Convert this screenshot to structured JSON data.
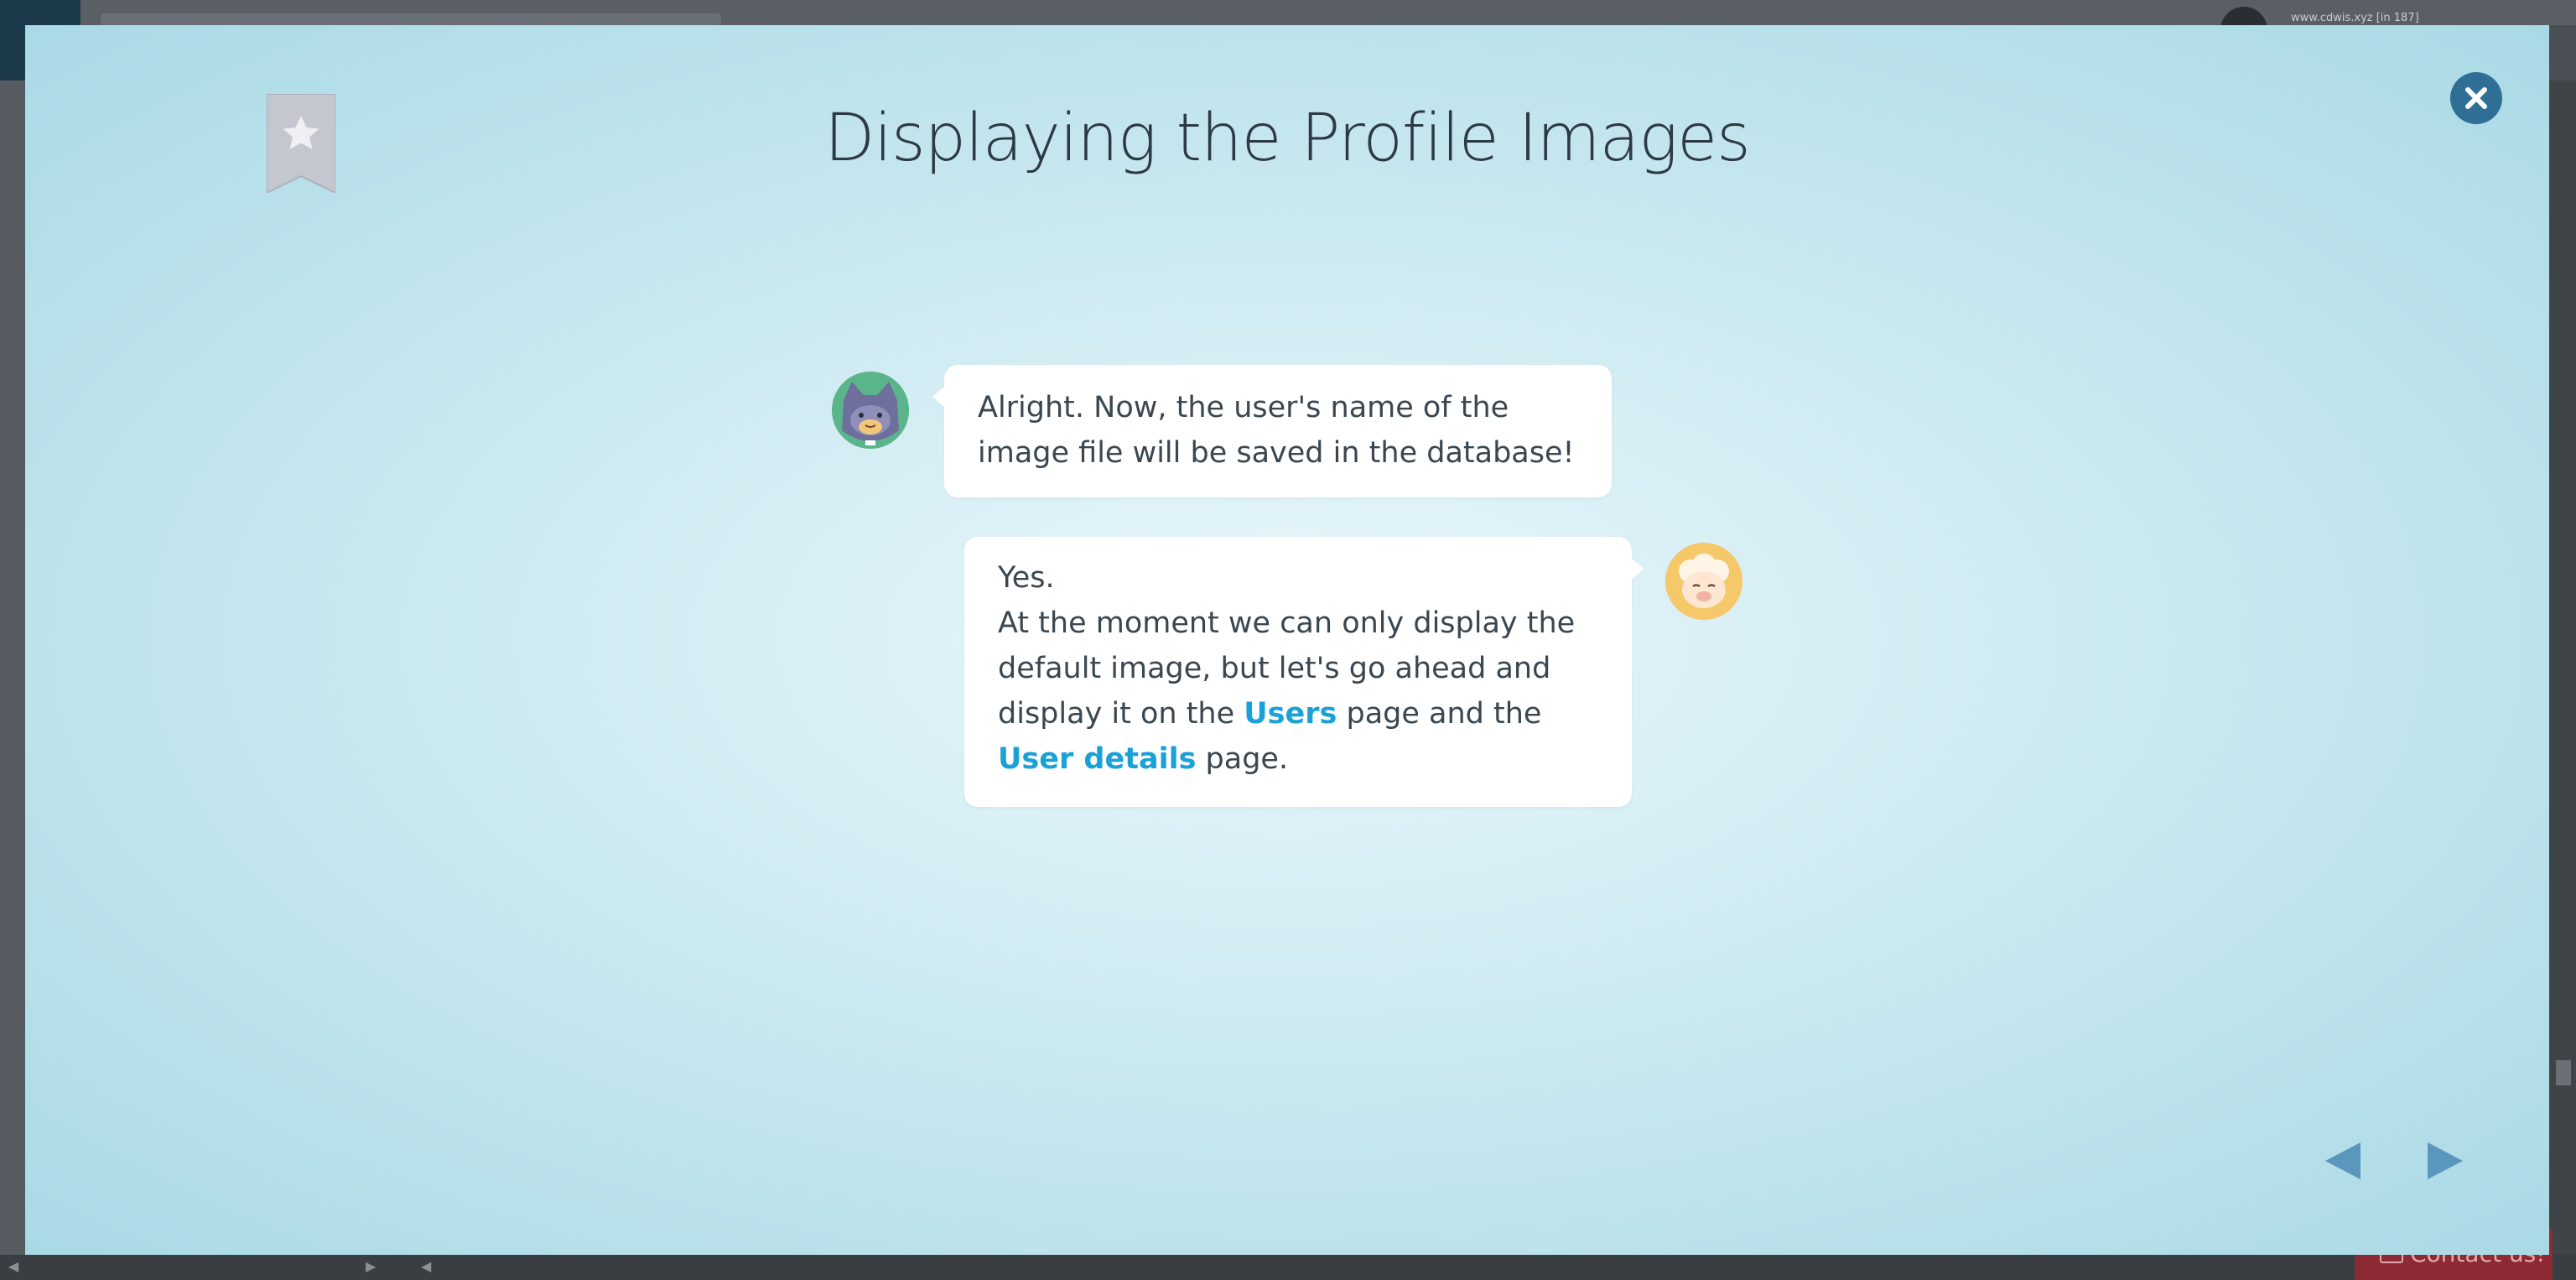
{
  "background": {
    "url_text": "www.cdwis.xyz [in 187]",
    "contact_label": "Contact us!"
  },
  "modal": {
    "title": "Displaying the Profile Images",
    "bookmark_icon": "bookmark-star-icon",
    "close_icon": "close-icon",
    "messages": [
      {
        "speaker": "cat",
        "text": "Alright. Now, the user's name of the image file will be saved in the database!"
      },
      {
        "speaker": "sheep",
        "line1": "Yes.",
        "part_a": "At the moment we can only display the default image, but let's go ahead and display it on the ",
        "highlight_1": "Users",
        "part_b": " page and the ",
        "highlight_2": "User details",
        "part_c": " page."
      }
    ],
    "nav": {
      "prev_icon": "triangle-left-icon",
      "next_icon": "triangle-right-icon"
    }
  },
  "colors": {
    "accent": "#1aa1d8",
    "close_button": "#2f6f95",
    "nav_arrow": "#5b96bd",
    "text": "#3a4650",
    "title": "#2d3a43"
  }
}
